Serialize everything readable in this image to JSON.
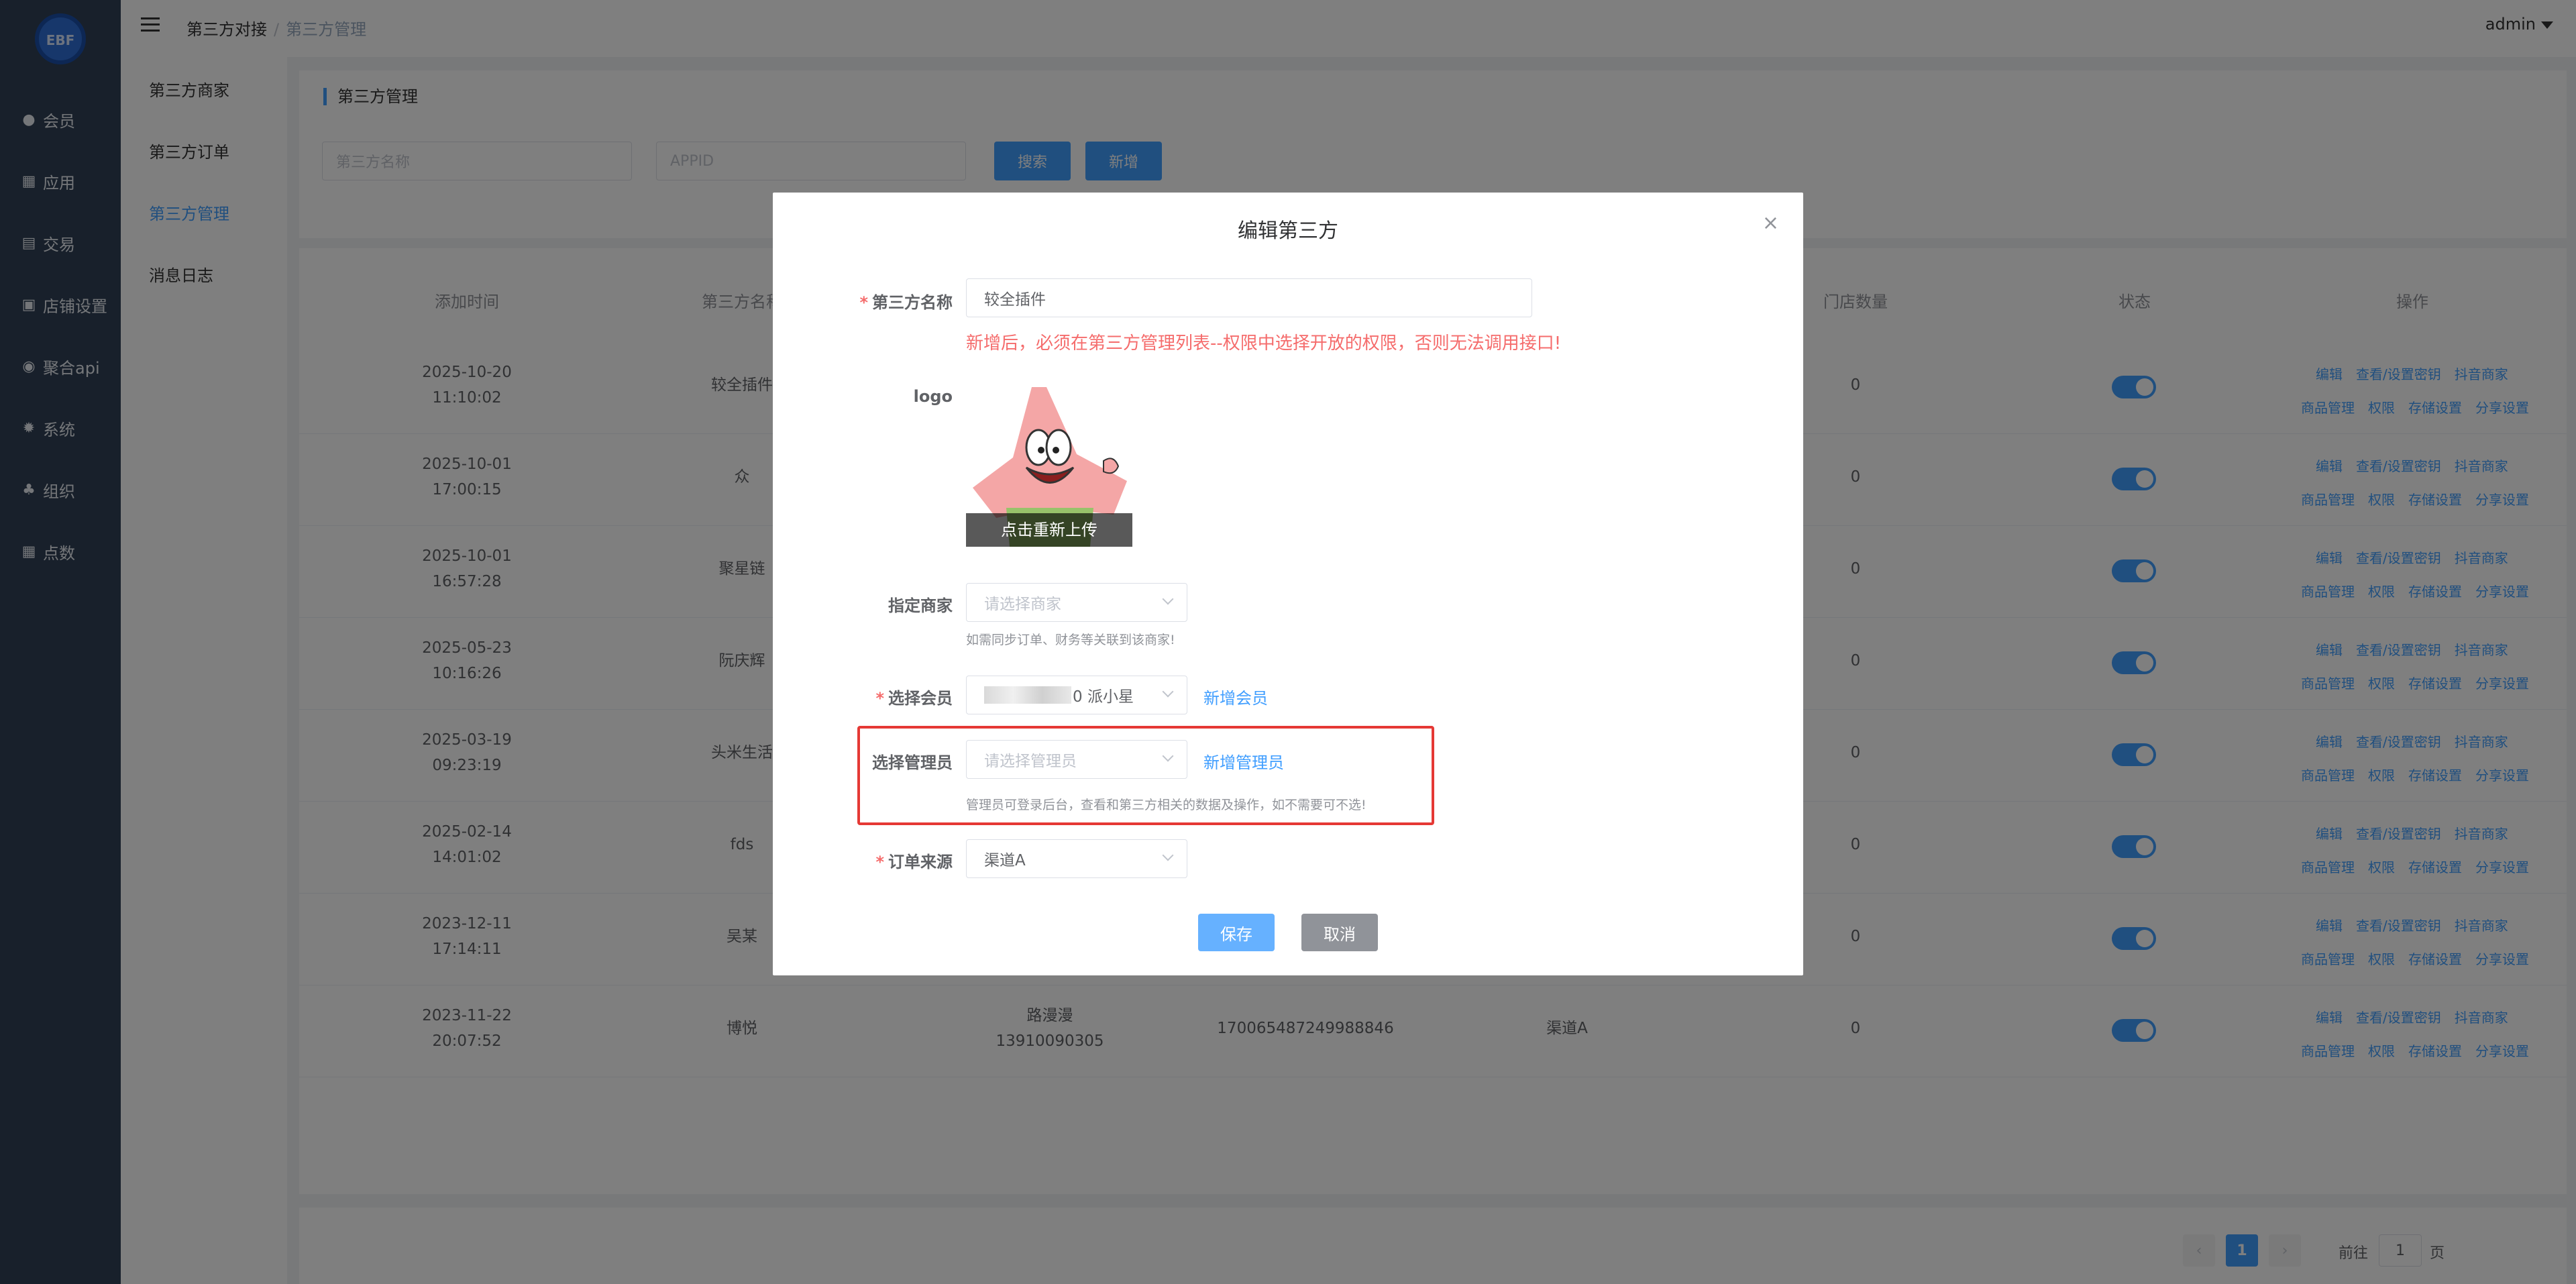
{
  "brand": {
    "logo_text": "EBF"
  },
  "sidebar": {
    "items": [
      {
        "label": "会员",
        "icon": "user-icon"
      },
      {
        "label": "应用",
        "icon": "grid-icon"
      },
      {
        "label": "交易",
        "icon": "document-icon"
      },
      {
        "label": "店铺设置",
        "icon": "store-icon"
      },
      {
        "label": "聚合api",
        "icon": "circle-icon"
      },
      {
        "label": "系统",
        "icon": "gear-icon"
      },
      {
        "label": "组织",
        "icon": "org-icon"
      },
      {
        "label": "点数",
        "icon": "grid-icon"
      }
    ]
  },
  "submenu": {
    "items": [
      {
        "label": "第三方商家"
      },
      {
        "label": "第三方订单"
      },
      {
        "label": "第三方管理"
      },
      {
        "label": "消息日志"
      }
    ],
    "active_index": 2
  },
  "header": {
    "breadcrumb": [
      "第三方对接",
      "第三方管理"
    ],
    "user": "admin"
  },
  "filter": {
    "title": "第三方管理",
    "name_placeholder": "第三方名称",
    "appid_placeholder": "APPID",
    "search_label": "搜索",
    "add_label": "新增"
  },
  "table": {
    "headers": [
      "添加时间",
      "第三方名称",
      "门店数量",
      "状态",
      "操作"
    ],
    "rows": [
      {
        "date": "2025-10-20",
        "time": "11:10:02",
        "name": "较全插件",
        "stores": "0"
      },
      {
        "date": "2025-10-01",
        "time": "17:00:15",
        "name": "众",
        "stores": "0"
      },
      {
        "date": "2025-10-01",
        "time": "16:57:28",
        "name": "聚星链",
        "stores": "0"
      },
      {
        "date": "2025-05-23",
        "time": "10:16:26",
        "name": "阮庆辉",
        "stores": "0"
      },
      {
        "date": "2025-03-19",
        "time": "09:23:19",
        "name": "头米生活",
        "stores": "0"
      },
      {
        "date": "2025-02-14",
        "time": "14:01:02",
        "name": "fds",
        "stores": "0"
      },
      {
        "date": "2023-12-11",
        "time": "17:14:11",
        "name": "吴某",
        "stores": "0"
      },
      {
        "date": "2023-11-22",
        "time": "20:07:52",
        "name": "博悦",
        "stores": "0",
        "member": "路漫漫",
        "phone": "13910090305",
        "appid": "170065487249988846",
        "channel": "渠道A"
      }
    ],
    "ops_row1": [
      "编辑",
      "查看/设置密钥",
      "抖音商家"
    ],
    "ops_row2": [
      "商品管理",
      "权限",
      "存储设置",
      "分享设置"
    ]
  },
  "pager": {
    "current": "1",
    "goto_prefix": "前往",
    "goto_value": "1",
    "goto_suffix": "页",
    "prev": "‹",
    "next": "›"
  },
  "dialog": {
    "title": "编辑第三方",
    "close": "×",
    "name_label": "第三方名称",
    "name_value": "较全插件",
    "warning": "新增后，必须在第三方管理列表--权限中选择开放的权限，否则无法调用接口!",
    "logo_label": "logo",
    "reupload": "点击重新上传",
    "merchant_label": "指定商家",
    "merchant_placeholder": "请选择商家",
    "merchant_hint": "如需同步订单、财务等关联到该商家!",
    "member_label": "选择会员",
    "member_value": "0 派小星",
    "add_member": "新增会员",
    "admin_label": "选择管理员",
    "admin_placeholder": "请选择管理员",
    "add_admin": "新增管理员",
    "admin_hint": "管理员可登录后台，查看和第三方相关的数据及操作，如不需要可不选!",
    "source_label": "订单来源",
    "source_value": "渠道A",
    "save": "保存",
    "cancel": "取消"
  },
  "colors": {
    "primary": "#409eff",
    "sidebar": "#304156",
    "danger": "#f56c6c",
    "highlight": "#e53935"
  }
}
